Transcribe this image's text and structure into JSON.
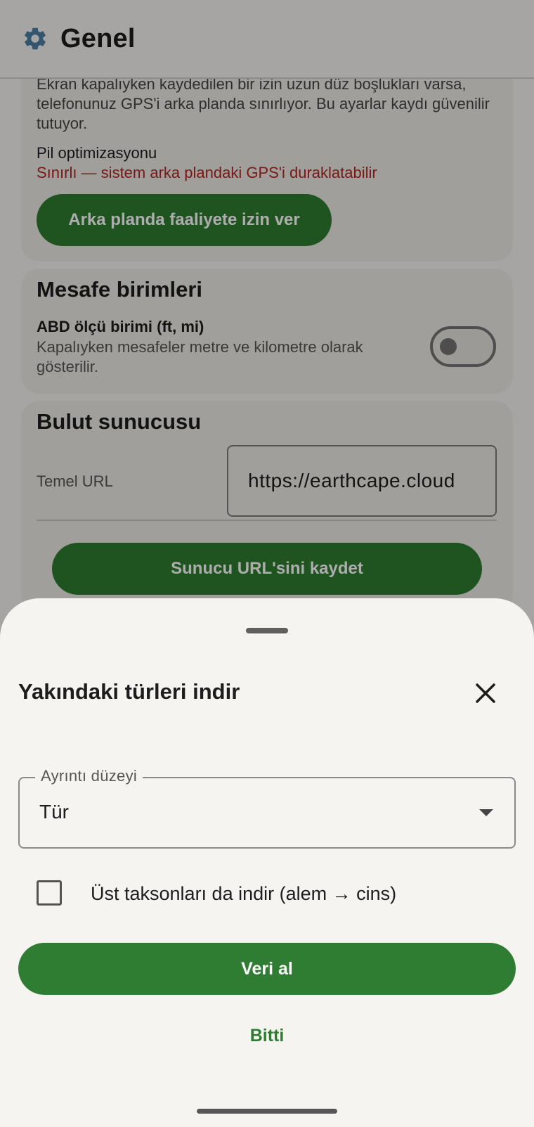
{
  "app_bar": {
    "title": "Genel",
    "icon": "gear-icon"
  },
  "background_page": {
    "gps_card": {
      "description": "Ekran kapalıyken kaydedilen bir izin uzun düz boşlukları varsa, telefonunuz GPS'i arka planda sınırlıyor. Bu ayarlar kaydı güvenilir tutuyor.",
      "battery_label": "Pil optimizasyonu",
      "battery_status": "Sınırlı — sistem arka plandaki GPS'i duraklatabilir",
      "allow_background_button": "Arka planda faaliyete izin ver"
    },
    "distance_units_card": {
      "title": "Mesafe birimleri",
      "us_units_label": "ABD ölçü birimi (ft, mi)",
      "us_units_description": "Kapalıyken mesafeler metre ve kilometre olarak gösterilir.",
      "us_units_enabled": false
    },
    "cloud_server_card": {
      "title": "Bulut sunucusu",
      "base_url_label": "Temel URL",
      "base_url_value": "https://earthcape.cloud",
      "save_button": "Sunucu URL'sini kaydet"
    }
  },
  "bottom_sheet": {
    "title": "Yakındaki türleri indir",
    "detail_level": {
      "label": "Ayrıntı düzeyi",
      "value": "Tür"
    },
    "include_parent_taxa": {
      "label": "Üst taksonları da indir (alem → cins)",
      "checked": false
    },
    "fetch_button": "Veri al",
    "done_button": "Bitti"
  },
  "colors": {
    "accent": "#2E7D32",
    "warning": "#B3261E",
    "surface": "#F6F4F0"
  }
}
